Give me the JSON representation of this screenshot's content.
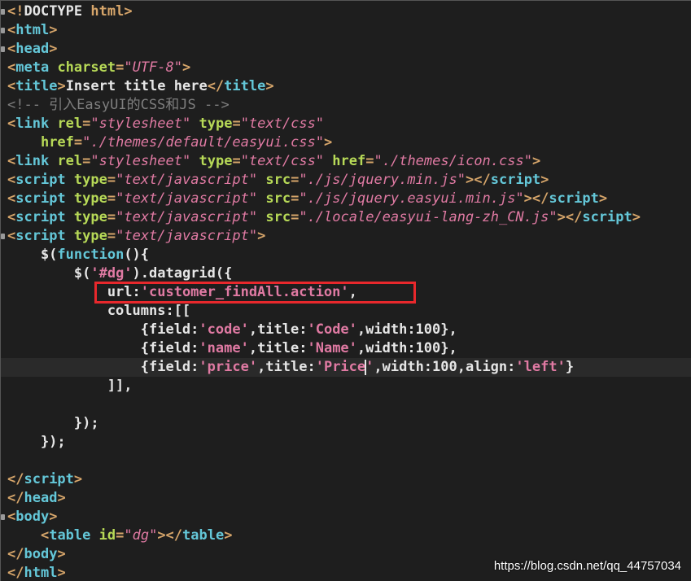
{
  "editor": {
    "lines": [
      [
        [
          "doctype-open",
          "<!"
        ],
        [
          "doctype",
          "DOCTYPE "
        ],
        [
          "doc-html",
          "html"
        ],
        [
          "punc",
          ">"
        ]
      ],
      [
        [
          "punc",
          "<"
        ],
        [
          "tag",
          "html"
        ],
        [
          "punc",
          ">"
        ]
      ],
      [
        [
          "punc",
          "<"
        ],
        [
          "tag",
          "head"
        ],
        [
          "punc",
          ">"
        ]
      ],
      [
        [
          "punc",
          "<"
        ],
        [
          "tag",
          "meta "
        ],
        [
          "attr",
          "charset"
        ],
        [
          "punc",
          "="
        ],
        [
          "str",
          "\"UTF-8\""
        ],
        [
          "punc",
          ">"
        ]
      ],
      [
        [
          "punc",
          "<"
        ],
        [
          "tag",
          "title"
        ],
        [
          "punc",
          ">"
        ],
        [
          "plain",
          "Insert title here"
        ],
        [
          "punc",
          "</"
        ],
        [
          "tag",
          "title"
        ],
        [
          "punc",
          ">"
        ]
      ],
      [
        [
          "comment",
          "<!-- 引入EasyUI的CSS和JS -->"
        ]
      ],
      [
        [
          "punc",
          "<"
        ],
        [
          "tag",
          "link "
        ],
        [
          "attr",
          "rel"
        ],
        [
          "punc",
          "="
        ],
        [
          "str",
          "\"stylesheet\""
        ],
        [
          "plain",
          " "
        ],
        [
          "attr",
          "type"
        ],
        [
          "punc",
          "="
        ],
        [
          "str",
          "\"text/css\""
        ]
      ],
      [
        [
          "plain",
          "    "
        ],
        [
          "attr",
          "href"
        ],
        [
          "punc",
          "="
        ],
        [
          "str",
          "\"./themes/default/easyui.css\""
        ],
        [
          "punc",
          ">"
        ]
      ],
      [
        [
          "punc",
          "<"
        ],
        [
          "tag",
          "link "
        ],
        [
          "attr",
          "rel"
        ],
        [
          "punc",
          "="
        ],
        [
          "str",
          "\"stylesheet\""
        ],
        [
          "plain",
          " "
        ],
        [
          "attr",
          "type"
        ],
        [
          "punc",
          "="
        ],
        [
          "str",
          "\"text/css\""
        ],
        [
          "plain",
          " "
        ],
        [
          "attr",
          "href"
        ],
        [
          "punc",
          "="
        ],
        [
          "str",
          "\"./themes/icon.css\""
        ],
        [
          "punc",
          ">"
        ]
      ],
      [
        [
          "punc",
          "<"
        ],
        [
          "tag",
          "script "
        ],
        [
          "attr",
          "type"
        ],
        [
          "punc",
          "="
        ],
        [
          "str",
          "\"text/javascript\""
        ],
        [
          "plain",
          " "
        ],
        [
          "attr",
          "src"
        ],
        [
          "punc",
          "="
        ],
        [
          "str",
          "\"./js/jquery.min.js\""
        ],
        [
          "punc",
          "></"
        ],
        [
          "tag",
          "script"
        ],
        [
          "punc",
          ">"
        ]
      ],
      [
        [
          "punc",
          "<"
        ],
        [
          "tag",
          "script "
        ],
        [
          "attr",
          "type"
        ],
        [
          "punc",
          "="
        ],
        [
          "str",
          "\"text/javascript\""
        ],
        [
          "plain",
          " "
        ],
        [
          "attr",
          "src"
        ],
        [
          "punc",
          "="
        ],
        [
          "str",
          "\"./js/jquery.easyui.min.js\""
        ],
        [
          "punc",
          "></"
        ],
        [
          "tag",
          "script"
        ],
        [
          "punc",
          ">"
        ]
      ],
      [
        [
          "punc",
          "<"
        ],
        [
          "tag",
          "script "
        ],
        [
          "attr",
          "type"
        ],
        [
          "punc",
          "="
        ],
        [
          "str",
          "\"text/javascript\""
        ],
        [
          "plain",
          " "
        ],
        [
          "attr",
          "src"
        ],
        [
          "punc",
          "="
        ],
        [
          "str",
          "\"./locale/easyui-lang-zh_CN.js\""
        ],
        [
          "punc",
          "></"
        ],
        [
          "tag",
          "script"
        ],
        [
          "punc",
          ">"
        ]
      ],
      [
        [
          "punc",
          "<"
        ],
        [
          "tag",
          "script "
        ],
        [
          "attr",
          "type"
        ],
        [
          "punc",
          "="
        ],
        [
          "str",
          "\"text/javascript\""
        ],
        [
          "punc",
          ">"
        ]
      ],
      [
        [
          "plain",
          "    $("
        ],
        [
          "kw",
          "function"
        ],
        [
          "plain",
          "(){"
        ]
      ],
      [
        [
          "plain",
          "        $("
        ],
        [
          "jsstr",
          "'#dg'"
        ],
        [
          "plain",
          ").datagrid({"
        ]
      ],
      [
        [
          "plain",
          "            url:"
        ],
        [
          "jsstr",
          "'customer_findAll.action'"
        ],
        [
          "plain",
          ","
        ]
      ],
      [
        [
          "plain",
          "            columns:[["
        ]
      ],
      [
        [
          "plain",
          "                {field:"
        ],
        [
          "jsstr",
          "'code'"
        ],
        [
          "plain",
          ",title:"
        ],
        [
          "jsstr",
          "'Code'"
        ],
        [
          "plain",
          ",width:100},"
        ]
      ],
      [
        [
          "plain",
          "                {field:"
        ],
        [
          "jsstr",
          "'name'"
        ],
        [
          "plain",
          ",title:"
        ],
        [
          "jsstr",
          "'Name'"
        ],
        [
          "plain",
          ",width:100},"
        ]
      ],
      [
        [
          "plain",
          "                {field:"
        ],
        [
          "jsstr",
          "'price'"
        ],
        [
          "plain",
          ",title:"
        ],
        [
          "jsstr",
          "'Price"
        ],
        [
          "caret",
          ""
        ],
        [
          "jsstr",
          "'"
        ],
        [
          "plain",
          ",width:100,align:"
        ],
        [
          "jsstr",
          "'left'"
        ],
        [
          "plain",
          "}"
        ]
      ],
      [
        [
          "plain",
          "            ]],"
        ]
      ],
      [
        [
          "plain",
          ""
        ]
      ],
      [
        [
          "plain",
          "        });"
        ]
      ],
      [
        [
          "plain",
          "    });"
        ]
      ],
      [
        [
          "plain",
          ""
        ]
      ],
      [
        [
          "punc",
          "</"
        ],
        [
          "tag",
          "script"
        ],
        [
          "punc",
          ">"
        ]
      ],
      [
        [
          "punc",
          "</"
        ],
        [
          "tag",
          "head"
        ],
        [
          "punc",
          ">"
        ]
      ],
      [
        [
          "punc",
          "<"
        ],
        [
          "tag",
          "body"
        ],
        [
          "punc",
          ">"
        ]
      ],
      [
        [
          "plain",
          "    "
        ],
        [
          "punc",
          "<"
        ],
        [
          "tag",
          "table "
        ],
        [
          "attr",
          "id"
        ],
        [
          "punc",
          "="
        ],
        [
          "str",
          "\"dg\""
        ],
        [
          "punc",
          "></"
        ],
        [
          "tag",
          "table"
        ],
        [
          "punc",
          ">"
        ]
      ],
      [
        [
          "punc",
          "</"
        ],
        [
          "tag",
          "body"
        ],
        [
          "punc",
          ">"
        ]
      ],
      [
        [
          "punc",
          "</"
        ],
        [
          "tag",
          "html"
        ],
        [
          "punc",
          ">"
        ]
      ]
    ],
    "fold_lines": [
      0,
      1,
      2,
      12,
      27
    ],
    "current_line": 19,
    "highlight_line": 15
  },
  "watermark": "https://blog.csdn.net/qq_44757034",
  "colors": {
    "background": "#1e1e1e",
    "tag": "#64c7d8",
    "attribute": "#b7d957",
    "string": "#e07aa3",
    "bracket": "#d6a56a",
    "comment": "#7f7f7f",
    "highlight_box": "#e8282c"
  }
}
